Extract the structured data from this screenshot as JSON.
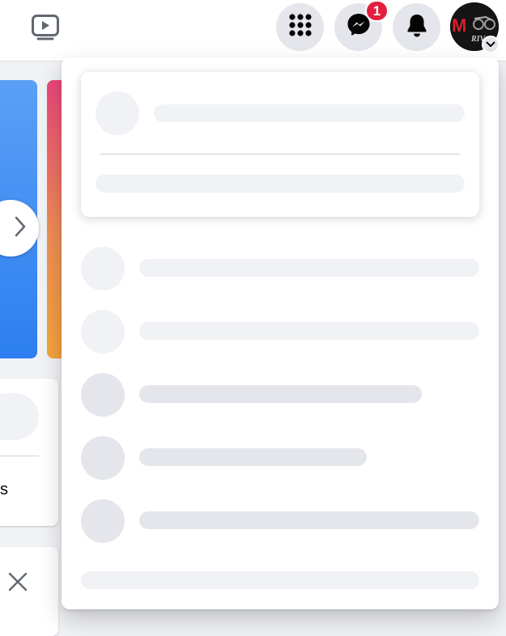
{
  "header": {
    "messenger_badge": "1",
    "icons": [
      "watch-icon",
      "menu-grid-icon",
      "messenger-icon",
      "bell-icon",
      "account-caret-icon"
    ],
    "avatar_alt": "profile"
  },
  "background": {
    "partial_label": "s"
  },
  "colors": {
    "badge": "#e41e3f",
    "skeleton": "#f0f2f5",
    "button_bg": "#e4e6eb"
  }
}
